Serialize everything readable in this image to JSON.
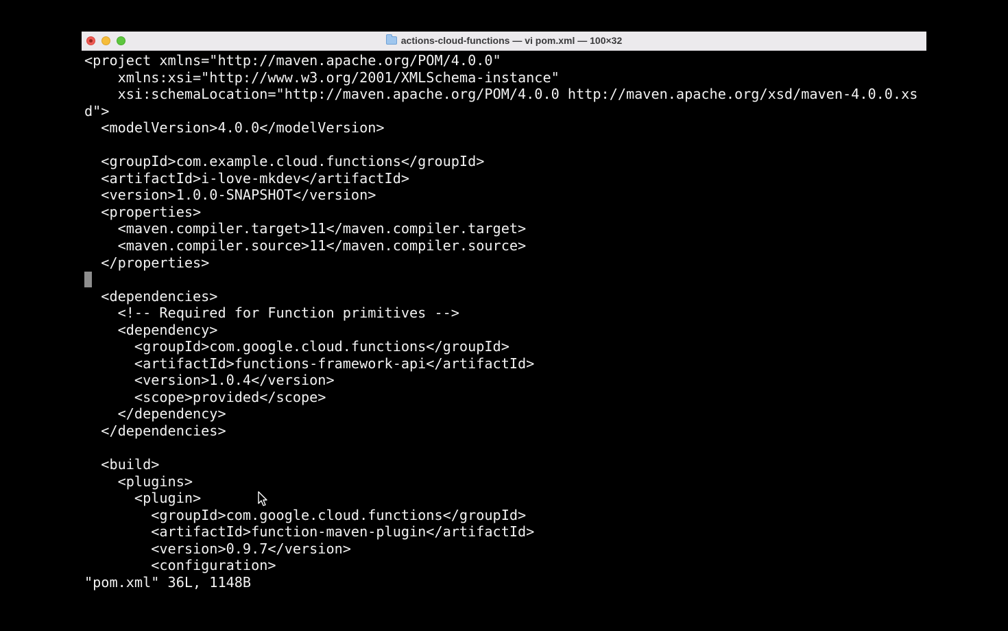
{
  "window": {
    "title": "actions-cloud-functions — vi pom.xml — 100×32"
  },
  "editor": {
    "lines": [
      "<project xmlns=\"http://maven.apache.org/POM/4.0.0\"",
      "    xmlns:xsi=\"http://www.w3.org/2001/XMLSchema-instance\"",
      "    xsi:schemaLocation=\"http://maven.apache.org/POM/4.0.0 http://maven.apache.org/xsd/maven-4.0.0.xs",
      "d\">",
      "  <modelVersion>4.0.0</modelVersion>",
      "",
      "  <groupId>com.example.cloud.functions</groupId>",
      "  <artifactId>i-love-mkdev</artifactId>",
      "  <version>1.0.0-SNAPSHOT</version>",
      "  <properties>",
      "    <maven.compiler.target>11</maven.compiler.target>",
      "    <maven.compiler.source>11</maven.compiler.source>",
      "  </properties>",
      "",
      "  <dependencies>",
      "    <!-- Required for Function primitives -->",
      "    <dependency>",
      "      <groupId>com.google.cloud.functions</groupId>",
      "      <artifactId>functions-framework-api</artifactId>",
      "      <version>1.0.4</version>",
      "      <scope>provided</scope>",
      "    </dependency>",
      "  </dependencies>",
      "",
      "  <build>",
      "    <plugins>",
      "      <plugin>",
      "        <groupId>com.google.cloud.functions</groupId>",
      "        <artifactId>function-maven-plugin</artifactId>",
      "        <version>0.9.7</version>",
      "        <configuration>"
    ],
    "cursor_line_index": 13,
    "status_line": "\"pom.xml\" 36L, 1148B"
  },
  "colors": {
    "terminal_background": "#000000",
    "terminal_text": "#f2f2f2",
    "titlebar_background": "#eceaed",
    "cursor": "#8e8e8e"
  },
  "icons": {
    "title_icon": "folder-icon",
    "pointer": "mouse-pointer-icon"
  }
}
